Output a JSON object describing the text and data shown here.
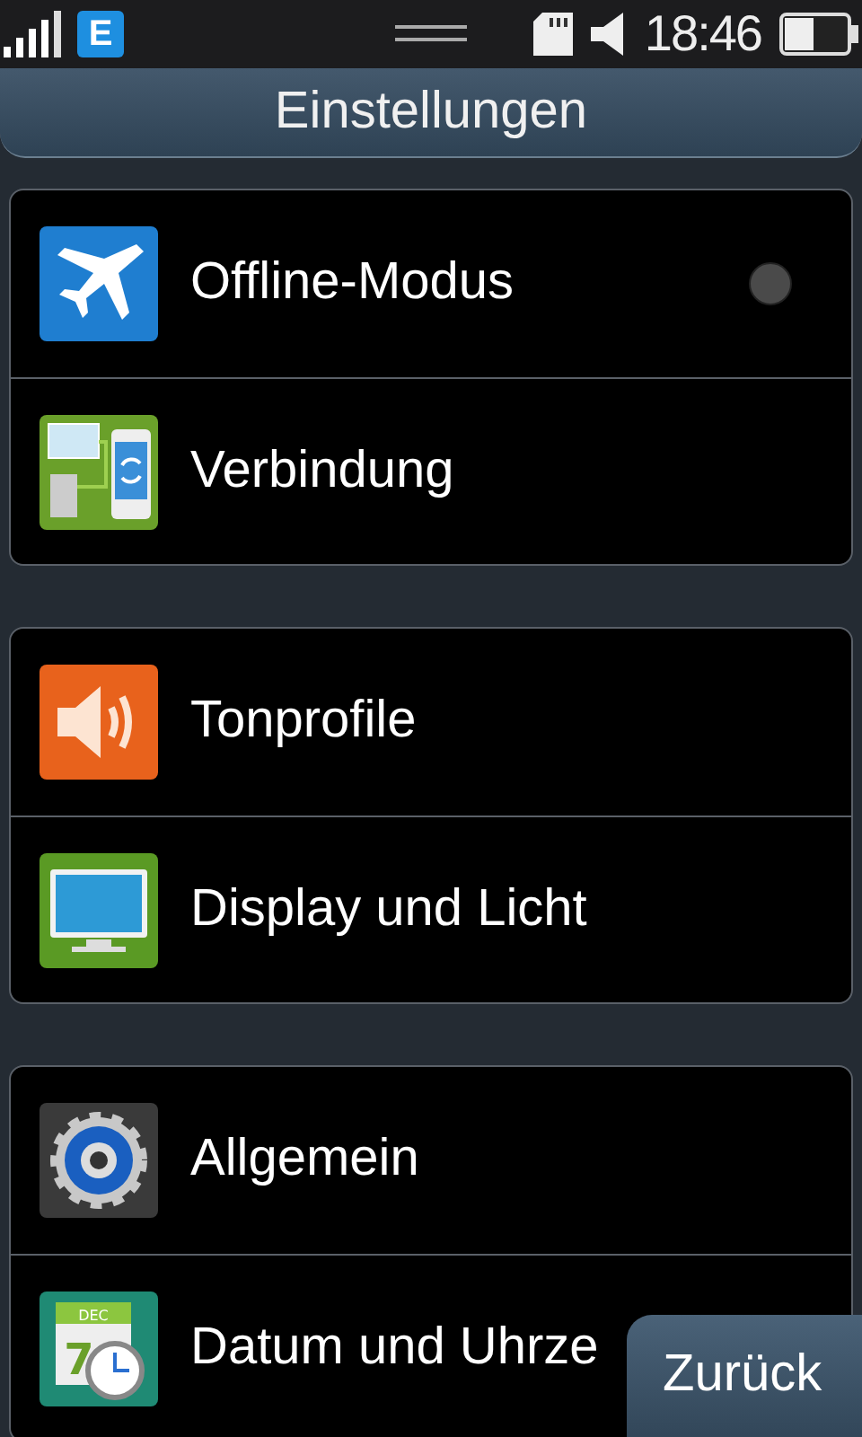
{
  "status_bar": {
    "network": "E",
    "time": "18:46"
  },
  "header": {
    "title": "Einstellungen"
  },
  "groups": [
    {
      "items": [
        {
          "label": "Offline-Modus",
          "kind": "toggle",
          "on": false
        },
        {
          "label": "Verbindung",
          "kind": "link"
        }
      ]
    },
    {
      "items": [
        {
          "label": "Tonprofile",
          "kind": "link"
        },
        {
          "label": "Display und Licht",
          "kind": "link"
        }
      ]
    },
    {
      "items": [
        {
          "label": "Allgemein",
          "kind": "link"
        },
        {
          "label": "Datum und Uhrze",
          "kind": "link",
          "icon_month": "DEC",
          "icon_day": "7"
        }
      ]
    }
  ],
  "back_button": "Zurück"
}
